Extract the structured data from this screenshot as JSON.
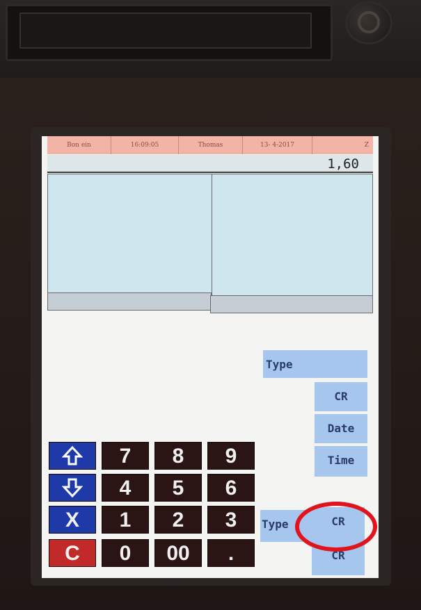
{
  "header": {
    "mode": "Bon ein",
    "time": "16:09:05",
    "operator": "Thomas",
    "date": "13- 4-2017",
    "indicator": "Z"
  },
  "display": {
    "amount": "1,60"
  },
  "softkeys": {
    "type_top": "Type",
    "cr_1": "CR",
    "date": "Date",
    "time": "Time",
    "type_bottom": "Type",
    "cr_2": "CR",
    "cr_3": "CR"
  },
  "numpad": {
    "up_icon": "arrow-up-icon",
    "down_icon": "arrow-down-icon",
    "multiply": "X",
    "clear": "C",
    "k7": "7",
    "k8": "8",
    "k9": "9",
    "k4": "4",
    "k5": "5",
    "k6": "6",
    "k1": "1",
    "k2": "2",
    "k3": "3",
    "k0": "0",
    "k00": "00",
    "kdot": "."
  },
  "colors": {
    "header_bg": "#f3b4a8",
    "softkey_bg": "#a7c6ee",
    "numpad_key": "#2a1414",
    "arrow_key": "#1e3aa8",
    "clear_key": "#c22a2a",
    "highlight": "#e0141c"
  }
}
